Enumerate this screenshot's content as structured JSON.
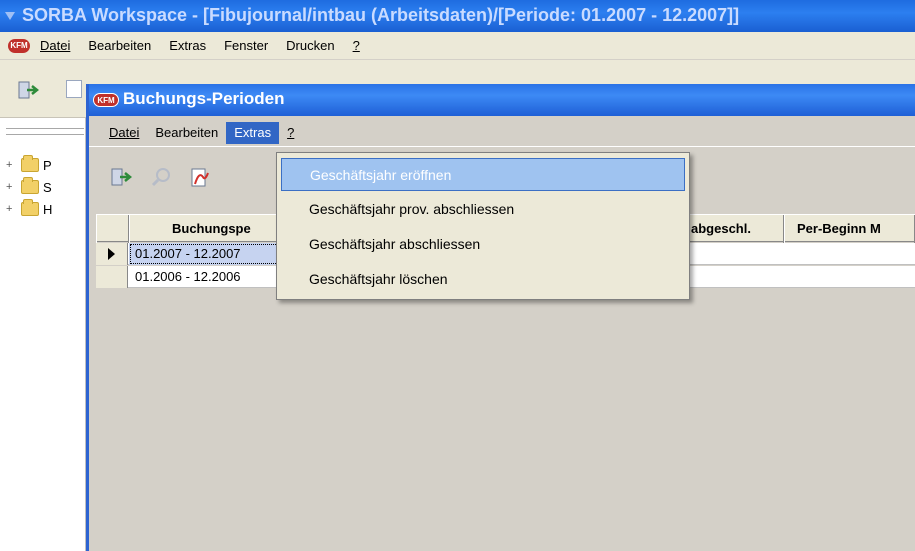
{
  "workspace": {
    "title": "SORBA Workspace - [Fibujournal/intbau (Arbeitsdaten)/[Periode: 01.2007 - 12.2007]]",
    "logo_text": "KFM",
    "menu": [
      "Datei",
      "Bearbeiten",
      "Extras",
      "Fenster",
      "Drucken",
      "?"
    ]
  },
  "tree": {
    "items": [
      {
        "label": "P",
        "icon": "folder-icon"
      },
      {
        "label": "S",
        "icon": "folder-icon"
      },
      {
        "label": "H",
        "icon": "folder-icon"
      }
    ]
  },
  "window": {
    "title": "Buchungs-Perioden",
    "logo_text": "KFM",
    "menu": [
      "Datei",
      "Bearbeiten",
      "Extras",
      "?"
    ],
    "active_menu": "Extras",
    "toolbar_icons": [
      "exit-icon",
      "search-icon",
      "report-icon"
    ]
  },
  "grid": {
    "columns": [
      "Buchungspe",
      "abgeschl.",
      "Per-Beginn M"
    ],
    "rows": [
      {
        "period": "01.2007 - 12.2007",
        "selected": true
      },
      {
        "period": "01.2006 - 12.2006",
        "selected": false
      }
    ]
  },
  "dropdown": {
    "items": [
      {
        "label": "Geschäftsjahr eröffnen",
        "highlighted": true
      },
      {
        "label": "Geschäftsjahr prov. abschliessen",
        "highlighted": false
      },
      {
        "label": "Geschäftsjahr abschliessen",
        "highlighted": false
      },
      {
        "label": "Geschäftsjahr löschen",
        "highlighted": false
      }
    ]
  },
  "colors": {
    "titlebar": "#2c7ff0",
    "menu_active": "#3166c5",
    "highlight": "#9fc3f0"
  }
}
